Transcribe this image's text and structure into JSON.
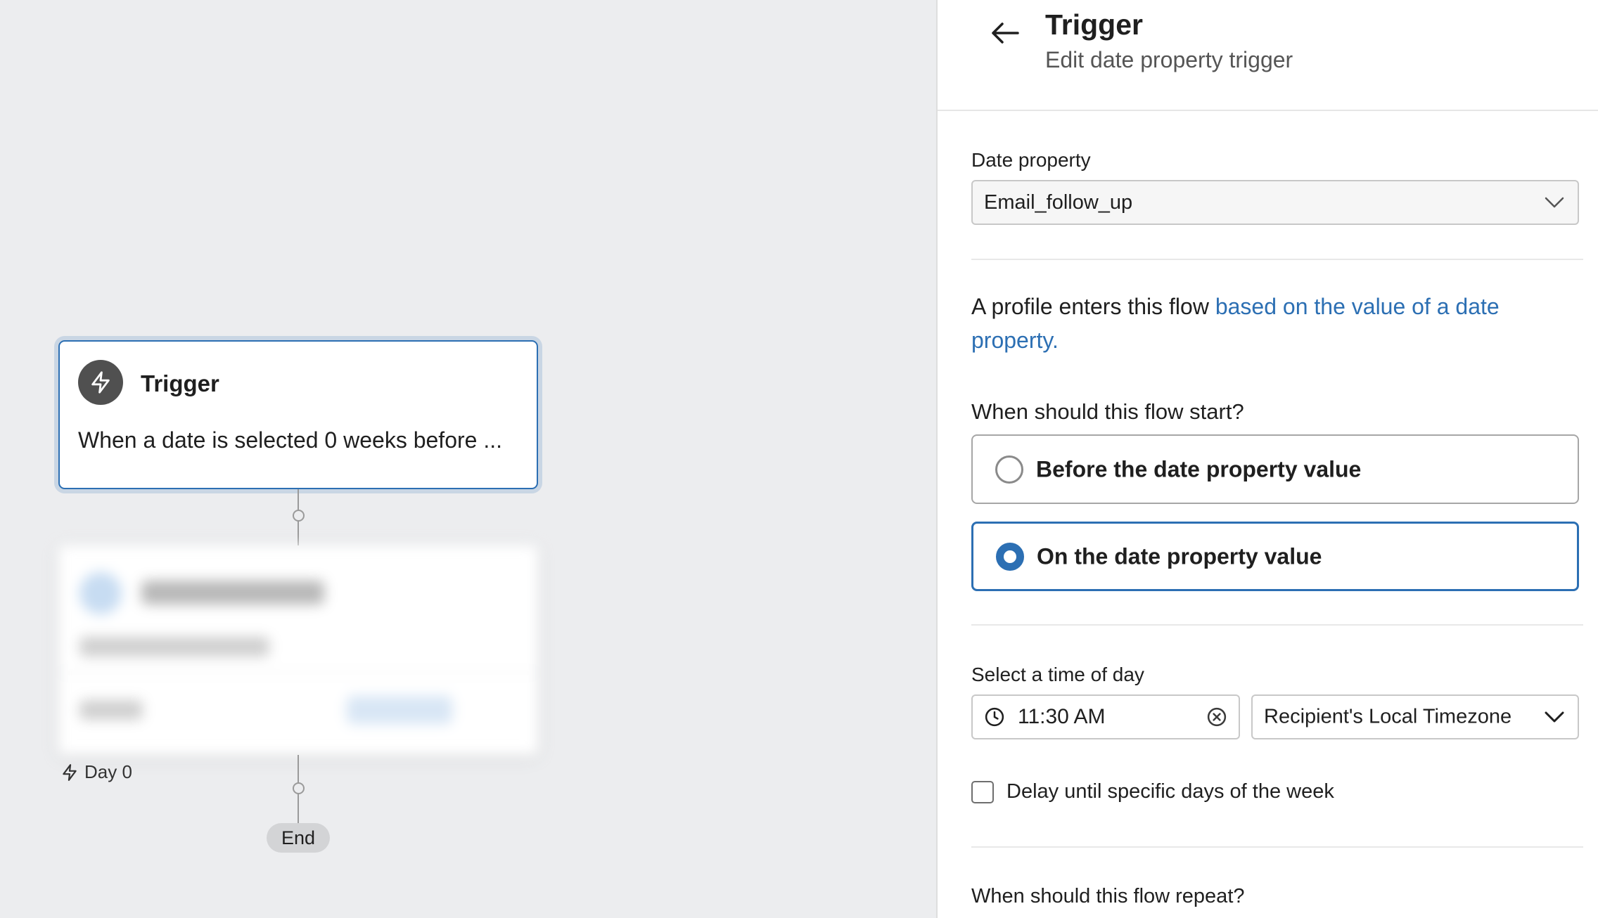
{
  "canvas": {
    "trigger_node": {
      "title": "Trigger",
      "description": "When a date is selected 0 weeks before ..."
    },
    "day_label": "Day 0",
    "end_label": "End"
  },
  "panel": {
    "title": "Trigger",
    "subtitle": "Edit date property trigger",
    "date_property": {
      "label": "Date property",
      "value": "Email_follow_up"
    },
    "info": {
      "prefix": "A profile enters this flow ",
      "link": "based on the value of a date property."
    },
    "flow_start": {
      "question": "When should this flow start?",
      "options": [
        {
          "label": "Before the date property value",
          "selected": false
        },
        {
          "label": "On the date property value",
          "selected": true
        }
      ]
    },
    "time_of_day": {
      "label": "Select a time of day",
      "time_value": "11:30 AM",
      "timezone_value": "Recipient's Local Timezone"
    },
    "delay_checkbox": {
      "label": "Delay until specific days of the week",
      "checked": false
    },
    "repeat_question": "When should this flow repeat?"
  },
  "colors": {
    "accent": "#2c6fb3",
    "canvas_bg": "#ecedef",
    "icon_bg": "#505050"
  }
}
